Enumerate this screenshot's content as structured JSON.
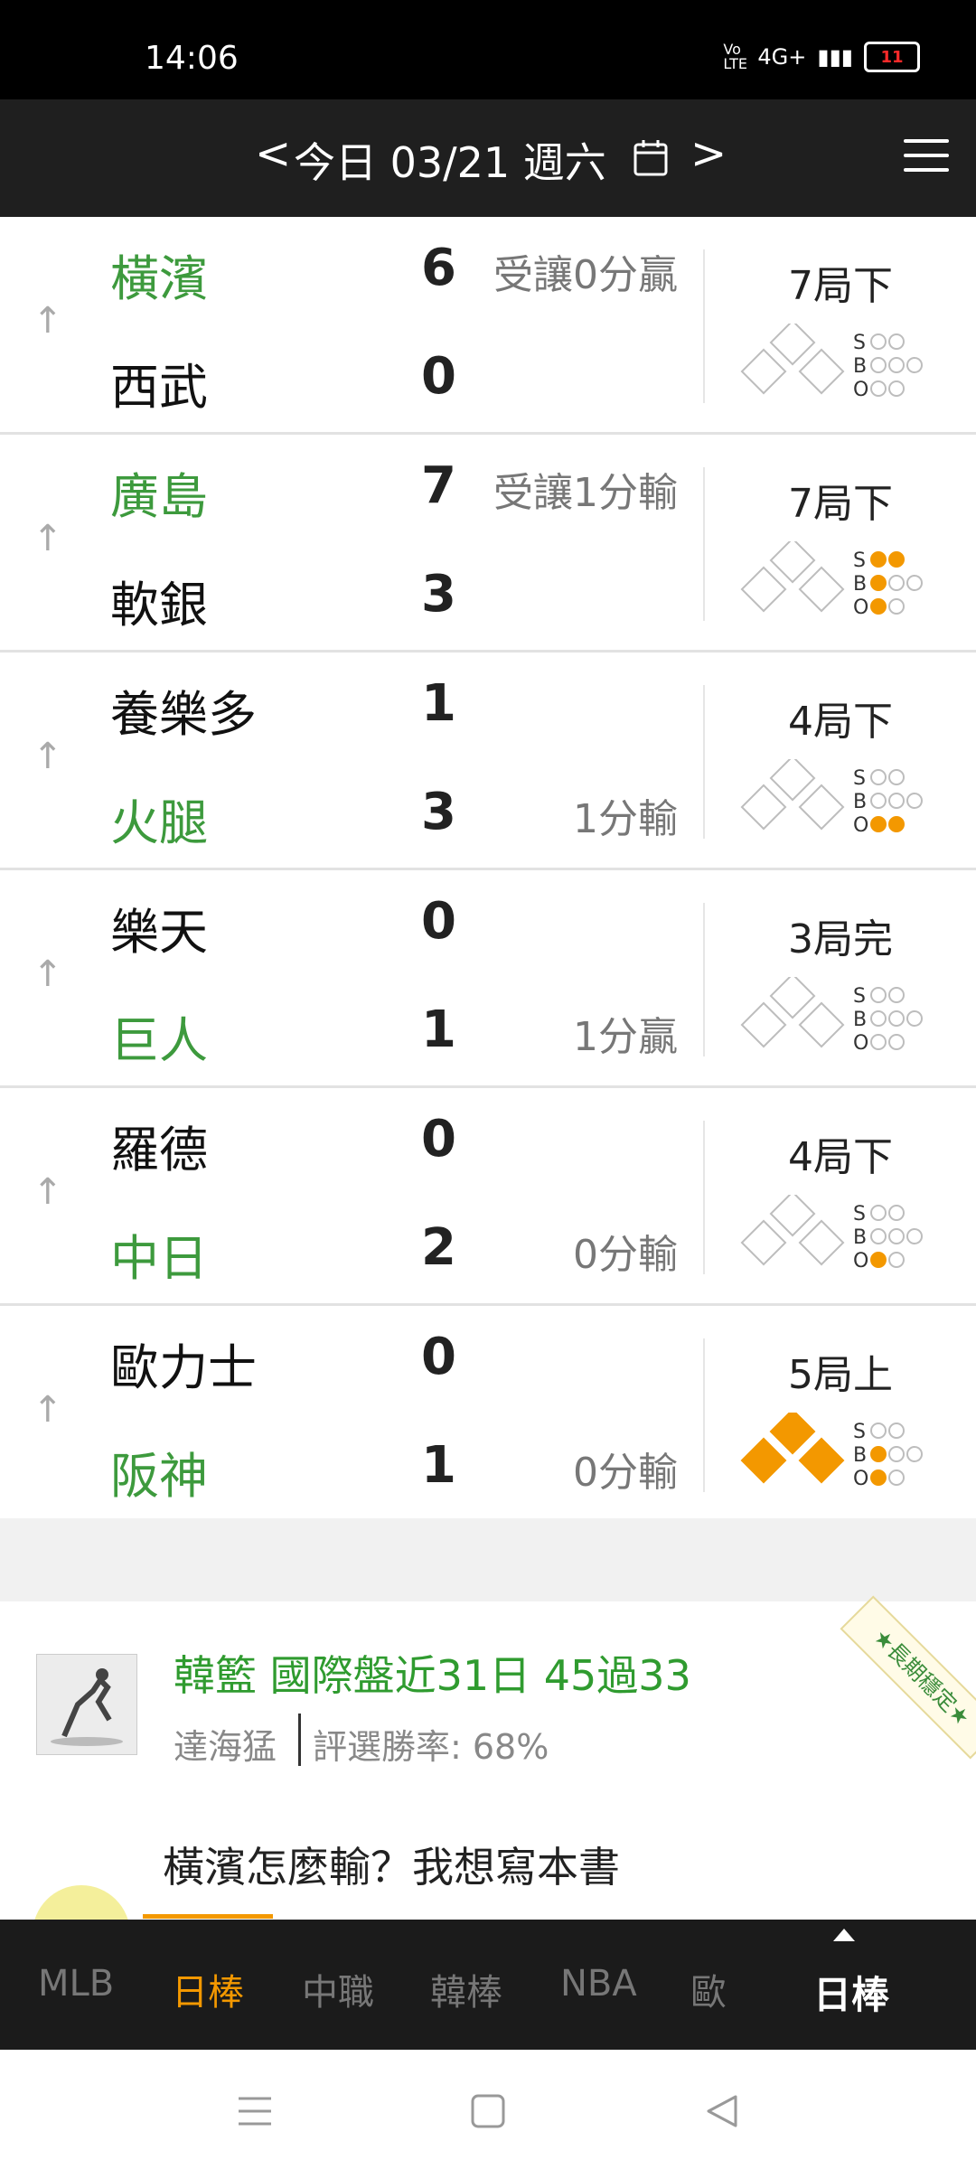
{
  "statusbar": {
    "time": "14:06",
    "network": "4G+",
    "volte": "Vo LTE",
    "battery": "11"
  },
  "header": {
    "prev": "<",
    "date": "今日 03/21 週六",
    "next": ">"
  },
  "games": [
    {
      "top": {
        "team": "橫濱",
        "color": "#3d9a3d",
        "score": "6",
        "odds": "受讓0分贏"
      },
      "bottom": {
        "team": "西武",
        "color": "#111111",
        "score": "0",
        "odds": ""
      },
      "inning": "7局下",
      "bases": [
        false,
        false,
        false
      ],
      "counts": {
        "S": [
          false,
          false
        ],
        "B": [
          false,
          false,
          false
        ],
        "O": [
          false,
          false
        ]
      }
    },
    {
      "top": {
        "team": "廣島",
        "color": "#3d9a3d",
        "score": "7",
        "odds": "受讓1分輸"
      },
      "bottom": {
        "team": "軟銀",
        "color": "#111111",
        "score": "3",
        "odds": ""
      },
      "inning": "7局下",
      "bases": [
        false,
        false,
        false
      ],
      "counts": {
        "S": [
          true,
          true
        ],
        "B": [
          true,
          false,
          false
        ],
        "O": [
          true,
          false
        ]
      }
    },
    {
      "top": {
        "team": "養樂多",
        "color": "#111111",
        "score": "1",
        "odds": ""
      },
      "bottom": {
        "team": "火腿",
        "color": "#3d9a3d",
        "score": "3",
        "odds": "1分輸"
      },
      "inning": "4局下",
      "bases": [
        false,
        false,
        false
      ],
      "counts": {
        "S": [
          false,
          false
        ],
        "B": [
          false,
          false,
          false
        ],
        "O": [
          true,
          true
        ]
      }
    },
    {
      "top": {
        "team": "樂天",
        "color": "#111111",
        "score": "0",
        "odds": ""
      },
      "bottom": {
        "team": "巨人",
        "color": "#3d9a3d",
        "score": "1",
        "odds": "1分贏"
      },
      "inning": "3局完",
      "bases": [
        false,
        false,
        false
      ],
      "counts": {
        "S": [
          false,
          false
        ],
        "B": [
          false,
          false,
          false
        ],
        "O": [
          false,
          false
        ]
      }
    },
    {
      "top": {
        "team": "羅德",
        "color": "#111111",
        "score": "0",
        "odds": ""
      },
      "bottom": {
        "team": "中日",
        "color": "#3d9a3d",
        "score": "2",
        "odds": "0分輸"
      },
      "inning": "4局下",
      "bases": [
        false,
        false,
        false
      ],
      "counts": {
        "S": [
          false,
          false
        ],
        "B": [
          false,
          false,
          false
        ],
        "O": [
          true,
          false
        ]
      }
    },
    {
      "top": {
        "team": "歐力士",
        "color": "#111111",
        "score": "0",
        "odds": ""
      },
      "bottom": {
        "team": "阪神",
        "color": "#3d9a3d",
        "score": "1",
        "odds": "0分輸"
      },
      "inning": "5局上",
      "bases": [
        true,
        true,
        true
      ],
      "counts": {
        "S": [
          false,
          false
        ],
        "B": [
          true,
          false,
          false
        ],
        "O": [
          true,
          false
        ]
      }
    }
  ],
  "promo": {
    "title": "韓籃 國際盤近31日 45過33",
    "author": "達海猛",
    "rate": "評選勝率: 68%",
    "ribbon": "★長期穩定★"
  },
  "article": {
    "title": "橫濱怎麼輸？我想寫本書"
  },
  "tabs": [
    "MLB",
    "日棒",
    "中職",
    "韓棒",
    "NBA",
    "歐"
  ],
  "active_tab": "日棒",
  "selected_league": "日棒",
  "colors": {
    "accent": "#f39800",
    "win_green": "#3d9a3d",
    "header_bg": "#1f1f1f"
  }
}
